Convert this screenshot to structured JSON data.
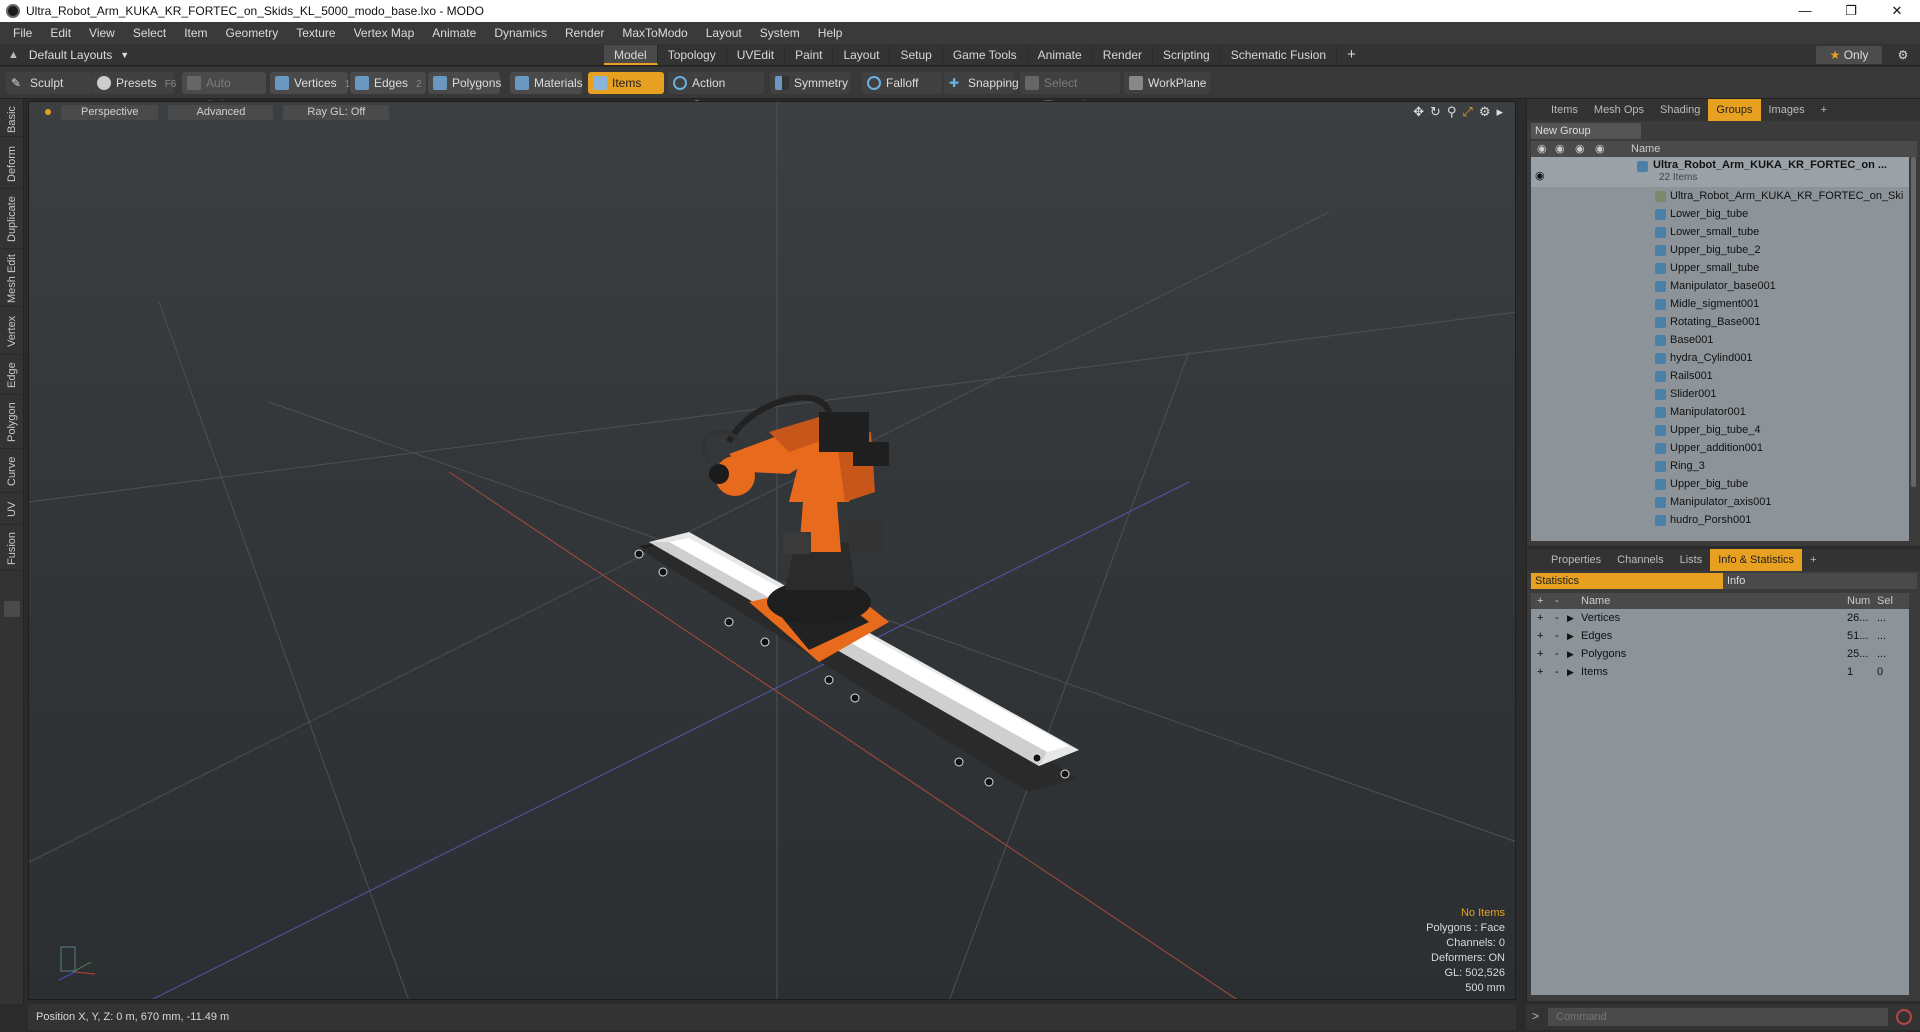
{
  "window": {
    "title": "Ultra_Robot_Arm_KUKA_KR_FORTEC_on_Skids_KL_5000_modo_base.lxo - MODO"
  },
  "menu": [
    "File",
    "Edit",
    "View",
    "Select",
    "Item",
    "Geometry",
    "Texture",
    "Vertex Map",
    "Animate",
    "Dynamics",
    "Render",
    "MaxToModo",
    "Layout",
    "System",
    "Help"
  ],
  "layout": {
    "selector": "Default Layouts",
    "tabs": [
      "Model",
      "Topology",
      "UVEdit",
      "Paint",
      "Layout",
      "Setup",
      "Game Tools",
      "Animate",
      "Render",
      "Scripting",
      "Schematic Fusion"
    ],
    "active_tab": "Model",
    "only_label": "Only"
  },
  "toolbar": {
    "sculpt": "Sculpt",
    "presets": "Presets",
    "presets_key": "F6",
    "auto_select": "Auto Select",
    "vertices": "Vertices",
    "vertices_key": "1",
    "edges": "Edges",
    "edges_key": "2",
    "polygons": "Polygons",
    "materials": "Materials",
    "items": "Items",
    "action_center": "Action Center",
    "symmetry": "Symmetry",
    "falloff": "Falloff",
    "snapping": "Snapping",
    "select_through": "Select Through",
    "workplane": "WorkPlane"
  },
  "left_tabs": [
    "Basic",
    "Deform",
    "Duplicate",
    "Mesh Edit",
    "Vertex",
    "Edge",
    "Polygon",
    "Curve",
    "UV",
    "Fusion"
  ],
  "viewport": {
    "view": "Perspective",
    "shading": "Advanced",
    "raygl": "Ray GL: Off",
    "info": {
      "selection": "No Items",
      "polygons": "Polygons : Face",
      "channels": "Channels: 0",
      "deformers": "Deformers: ON",
      "gl": "GL: 502,526",
      "scale": "500 mm"
    }
  },
  "status": {
    "position": "Position X, Y, Z:  0 m, 670 mm, -11.49 m"
  },
  "top_panel": {
    "tabs": [
      "Items",
      "Mesh Ops",
      "Shading",
      "Groups",
      "Images"
    ],
    "active_tab": "Groups",
    "new_group": "New Group",
    "name_header": "Name",
    "group_name": "Ultra_Robot_Arm_KUKA_KR_FORTEC_on ...",
    "group_count": "22 Items",
    "items": [
      "Ultra_Robot_Arm_KUKA_KR_FORTEC_on_Ski ...",
      "Lower_big_tube",
      "Lower_small_tube",
      "Upper_big_tube_2",
      "Upper_small_tube",
      "Manipulator_base001",
      "Midle_sigment001",
      "Rotating_Base001",
      "Base001",
      "hydra_Cylind001",
      "Rails001",
      "Slider001",
      "Manipulator001",
      "Upper_big_tube_4",
      "Upper_addition001",
      "Ring_3",
      "Upper_big_tube",
      "Manipulator_axis001",
      "hudro_Porsh001"
    ]
  },
  "bottom_panel": {
    "tabs": [
      "Properties",
      "Channels",
      "Lists",
      "Info & Statistics"
    ],
    "active_tab": "Info & Statistics",
    "sub_tabs": [
      "Statistics",
      "Info"
    ],
    "headers": {
      "name": "Name",
      "num": "Num",
      "sel": "Sel"
    },
    "rows": [
      {
        "name": "Vertices",
        "num": "26...",
        "sel": "..."
      },
      {
        "name": "Edges",
        "num": "51...",
        "sel": "..."
      },
      {
        "name": "Polygons",
        "num": "25...",
        "sel": "..."
      },
      {
        "name": "Items",
        "num": "1",
        "sel": "0"
      }
    ]
  },
  "command": {
    "placeholder": "Command"
  }
}
